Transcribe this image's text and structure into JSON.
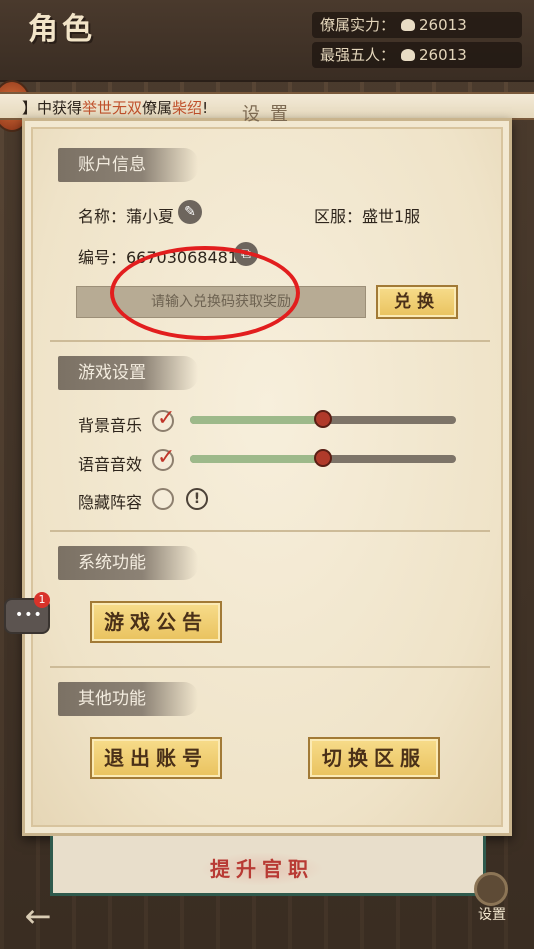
{
  "header": {
    "title": "角色",
    "stats": [
      {
        "label": "僚属实力：",
        "value": "26013"
      },
      {
        "label": "最强五人：",
        "value": "26013"
      }
    ]
  },
  "ticker": {
    "prefix": "】中获得",
    "highlight1": "举世无双",
    "middle": "僚属",
    "highlight2": "柴绍",
    "suffix": "!"
  },
  "panel": {
    "title": "设置",
    "account": {
      "header": "账户信息",
      "name_label": "名称：蒲小夏",
      "server_label": "区服：盛世1服",
      "id_label": "编号：667030684819",
      "redeem_placeholder": "请输入兑换码获取奖励",
      "redeem_button": "兑换"
    },
    "game_settings": {
      "header": "游戏设置",
      "bgm_label": "背景音乐",
      "bgm_checked": true,
      "bgm_level": 0.5,
      "sfx_label": "语音音效",
      "sfx_checked": true,
      "sfx_level": 0.5,
      "hide_lineup_label": "隐藏阵容",
      "hide_lineup_checked": false,
      "info_icon_glyph": "!"
    },
    "system": {
      "header": "系统功能",
      "announcement_button": "游戏公告"
    },
    "other": {
      "header": "其他功能",
      "logout_button": "退出账号",
      "switch_server_button": "切换区服"
    }
  },
  "chat": {
    "badge_count": "1",
    "dots": "•••"
  },
  "bottom": {
    "promote_button": "提升官职",
    "back_glyph": "←",
    "settings_label": "设置"
  },
  "colors": {
    "annotation_circle": "#e21e1e",
    "accent_gold": "#e9c25e",
    "highlight_text": "#c0512c"
  }
}
